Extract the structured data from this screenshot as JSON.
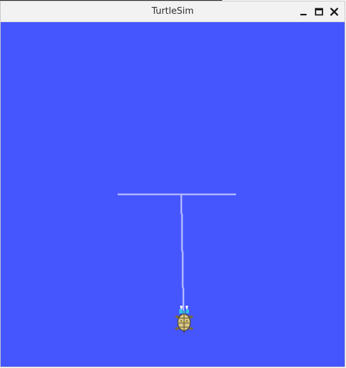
{
  "window": {
    "title": "TurtleSim"
  },
  "titlebar": {
    "controls": [
      {
        "name": "minimize-button",
        "icon": "minimize-icon"
      },
      {
        "name": "maximize-button",
        "icon": "maximize-icon"
      },
      {
        "name": "close-button",
        "icon": "close-icon"
      }
    ]
  },
  "canvas": {
    "background_color": "#4556ff",
    "pen_color": "#b3b8ff",
    "turtle": {
      "icon": "turtle-icon"
    }
  }
}
